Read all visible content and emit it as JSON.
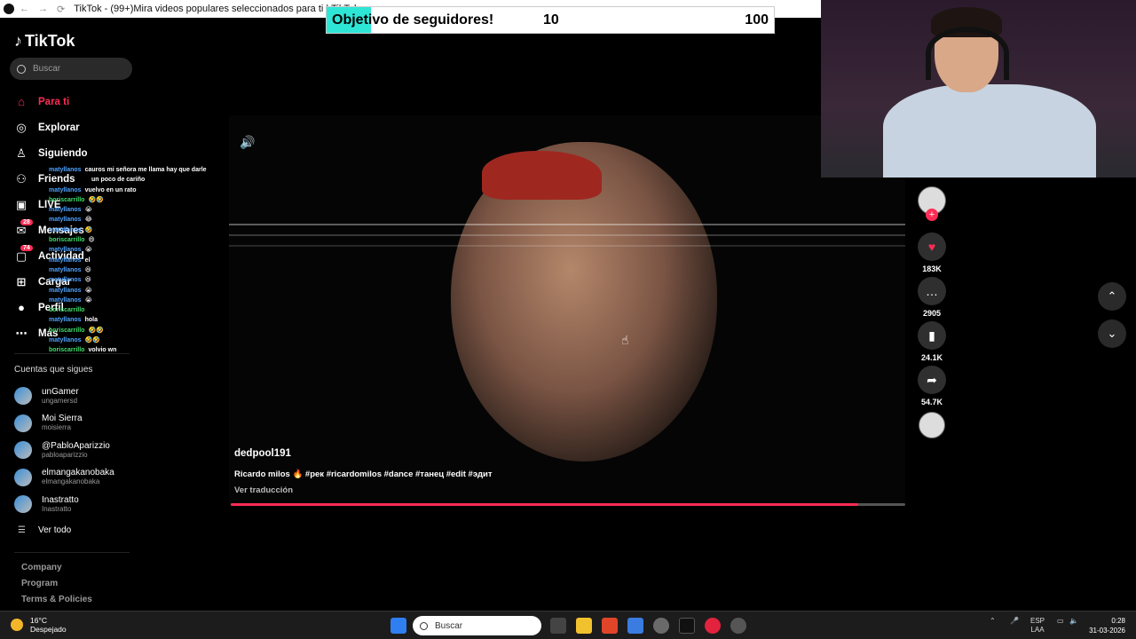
{
  "browser": {
    "title": "TikTok - (99+)Mira videos populares seleccionados para ti | TikTok"
  },
  "goal": {
    "label": "Objetivo de seguidores!",
    "current": "10",
    "max": "100",
    "fill_fraction": 0.1
  },
  "sidebar": {
    "brand": "TikTok",
    "search_placeholder": "Buscar",
    "nav": [
      {
        "label": "Para ti",
        "icon": "home-icon",
        "active": true
      },
      {
        "label": "Explorar",
        "icon": "compass-icon"
      },
      {
        "label": "Siguiendo",
        "icon": "user-follow-icon"
      },
      {
        "label": "Friends",
        "icon": "friends-icon"
      },
      {
        "label": "LIVE",
        "icon": "live-icon"
      },
      {
        "label": "Mensajes",
        "icon": "message-icon",
        "badge": "28"
      },
      {
        "label": "Actividad",
        "icon": "activity-icon",
        "badge": "74"
      },
      {
        "label": "Cargar",
        "icon": "upload-icon"
      },
      {
        "label": "Perfil",
        "icon": "profile-icon"
      },
      {
        "label": "Más",
        "icon": "more-icon"
      }
    ],
    "following_title": "Cuentas que sigues",
    "following": [
      {
        "name": "unGamer",
        "handle": "ungamersd"
      },
      {
        "name": "Moi Sierra",
        "handle": "moisierra"
      },
      {
        "name": "@PabloAparizzio",
        "handle": "pabloaparizzio"
      },
      {
        "name": "elmangakanobaka",
        "handle": "elmangakanobaka"
      },
      {
        "name": "Inastratto",
        "handle": "Inastratto"
      }
    ],
    "see_all": "Ver todo",
    "footer": [
      "Company",
      "Program",
      "Terms & Policies"
    ]
  },
  "chat": [
    {
      "user": "matyllanos",
      "msg": "cauros mi señora me llama hay que darle",
      "c": 1
    },
    {
      "user": "",
      "msg": "un poco de cariño",
      "c": 1
    },
    {
      "user": "matyllanos",
      "msg": "vuelvo en un rato",
      "c": 1
    },
    {
      "user": "boriscarrillo",
      "msg": "🤣🤣",
      "c": 2
    },
    {
      "user": "matyllanos",
      "msg": "😭",
      "c": 1
    },
    {
      "user": "matyllanos",
      "msg": "😂",
      "c": 1
    },
    {
      "user": "matyllanos",
      "msg": "🤣",
      "c": 1
    },
    {
      "user": "boriscarrillo",
      "msg": "😄",
      "c": 2
    },
    {
      "user": "matyllanos",
      "msg": "😭",
      "c": 1
    },
    {
      "user": "matyllanos",
      "msg": "el",
      "c": 1
    },
    {
      "user": "matyllanos",
      "msg": "😆",
      "c": 1
    },
    {
      "user": "matyllanos",
      "msg": "😆",
      "c": 1
    },
    {
      "user": "matyllanos",
      "msg": "😭",
      "c": 1
    },
    {
      "user": "matyllanos",
      "msg": "😭",
      "c": 1
    },
    {
      "user": "boriscarrillo",
      "msg": "",
      "c": 2
    },
    {
      "user": "matyllanos",
      "msg": "hola",
      "c": 1
    },
    {
      "user": "boriscarrillo",
      "msg": "🤣🤣",
      "c": 2
    },
    {
      "user": "matyllanos",
      "msg": "🤣🤣",
      "c": 1
    },
    {
      "user": "boriscarrillo",
      "msg": "volvio wn",
      "c": 2
    }
  ],
  "video": {
    "author": "dedpool191",
    "caption": "Ricardo milos 🔥 #рек #ricardomilos #dance #танец #edit #эдит",
    "translate": "Ver traducción",
    "progress_fraction": 0.93
  },
  "actions": [
    {
      "icon": "heart-icon",
      "count": "183K"
    },
    {
      "icon": "comment-icon",
      "count": "2905"
    },
    {
      "icon": "bookmark-icon",
      "count": "24.1K"
    },
    {
      "icon": "share-icon",
      "count": "54.7K"
    }
  ],
  "taskbar": {
    "temp": "16°C",
    "weather": "Despejado",
    "search_placeholder": "Buscar",
    "lang1": "ESP",
    "lang2": "LAA",
    "time": "0:28",
    "date": "31-03-2026"
  },
  "colors": {
    "accent": "#fe2c55",
    "goal_fill": "#2ee6d6"
  }
}
